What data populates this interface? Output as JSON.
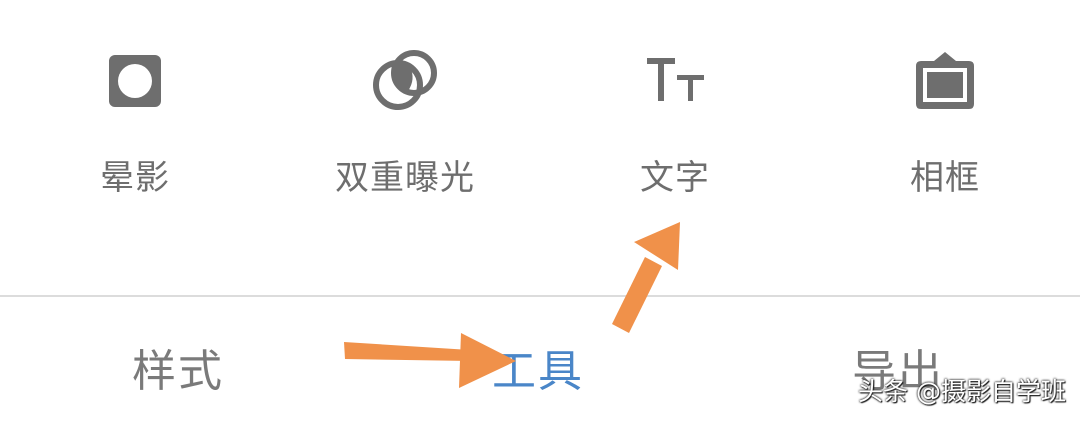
{
  "tools": [
    {
      "label": "晕影",
      "icon": "vignette-icon"
    },
    {
      "label": "双重曝光",
      "icon": "double-exposure-icon"
    },
    {
      "label": "文字",
      "icon": "text-icon"
    },
    {
      "label": "相框",
      "icon": "frame-icon"
    }
  ],
  "tabs": [
    {
      "label": "样式",
      "active": false
    },
    {
      "label": "工具",
      "active": true
    },
    {
      "label": "导出",
      "active": false
    }
  ],
  "watermark": "头条 @摄影自学班",
  "colors": {
    "icon": "#6e6e6e",
    "label": "#6e6e6e",
    "tab": "#7a7a7a",
    "tab_active": "#4a86c8",
    "annotation_arrow": "#f0914a"
  }
}
